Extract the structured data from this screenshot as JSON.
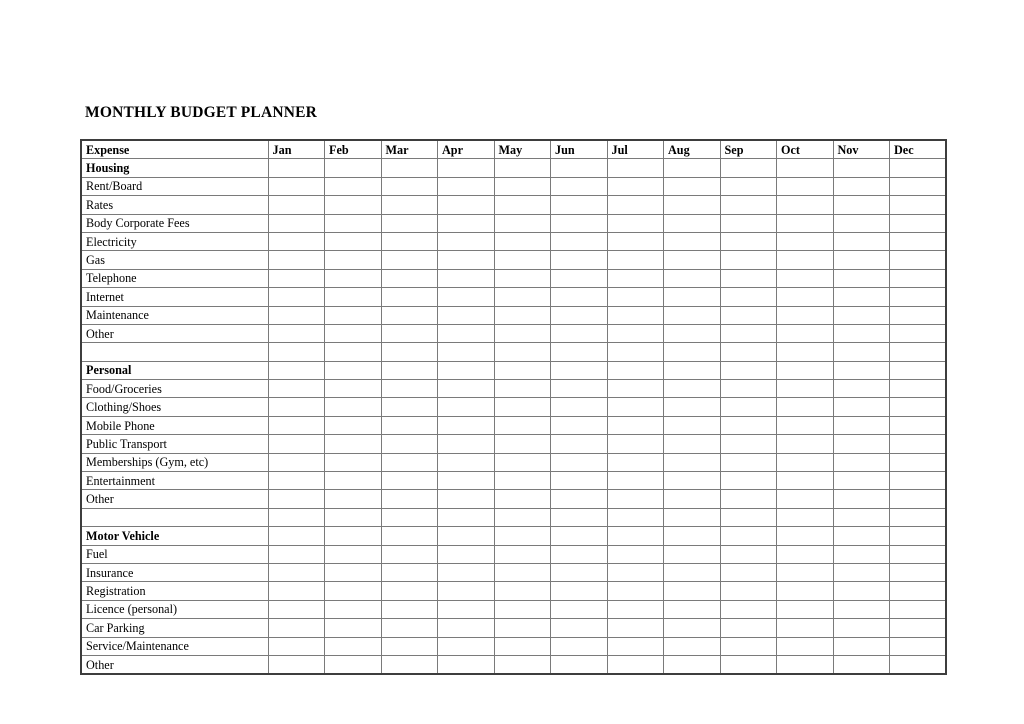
{
  "document": {
    "title": "MONTHLY BUDGET PLANNER"
  },
  "table": {
    "expense_header": "Expense",
    "months": [
      "Jan",
      "Feb",
      "Mar",
      "Apr",
      "May",
      "Jun",
      "Jul",
      "Aug",
      "Sep",
      "Oct",
      "Nov",
      "Dec"
    ],
    "rows": [
      {
        "type": "section",
        "label": "Housing"
      },
      {
        "type": "item",
        "label": "Rent/Board"
      },
      {
        "type": "item",
        "label": "Rates"
      },
      {
        "type": "item",
        "label": "Body Corporate Fees"
      },
      {
        "type": "item",
        "label": "Electricity"
      },
      {
        "type": "item",
        "label": "Gas"
      },
      {
        "type": "item",
        "label": "Telephone"
      },
      {
        "type": "item",
        "label": "Internet"
      },
      {
        "type": "item",
        "label": "Maintenance"
      },
      {
        "type": "item",
        "label": "Other"
      },
      {
        "type": "spacer",
        "label": ""
      },
      {
        "type": "section",
        "label": "Personal"
      },
      {
        "type": "item",
        "label": "Food/Groceries"
      },
      {
        "type": "item",
        "label": "Clothing/Shoes"
      },
      {
        "type": "item",
        "label": "Mobile Phone"
      },
      {
        "type": "item",
        "label": "Public Transport"
      },
      {
        "type": "item",
        "label": "Memberships (Gym, etc)"
      },
      {
        "type": "item",
        "label": "Entertainment"
      },
      {
        "type": "item",
        "label": "Other"
      },
      {
        "type": "spacer",
        "label": ""
      },
      {
        "type": "section",
        "label": "Motor Vehicle"
      },
      {
        "type": "item",
        "label": "Fuel"
      },
      {
        "type": "item",
        "label": "Insurance"
      },
      {
        "type": "item",
        "label": "Registration"
      },
      {
        "type": "item",
        "label": "Licence (personal)"
      },
      {
        "type": "item",
        "label": "Car Parking"
      },
      {
        "type": "item",
        "label": "Service/Maintenance"
      },
      {
        "type": "item",
        "label": "Other"
      }
    ]
  },
  "colors": {
    "page_background": "#ffffff",
    "text": "#000000",
    "grid_line": "#7a7a7a",
    "outer_border": "#3d3d3d"
  }
}
